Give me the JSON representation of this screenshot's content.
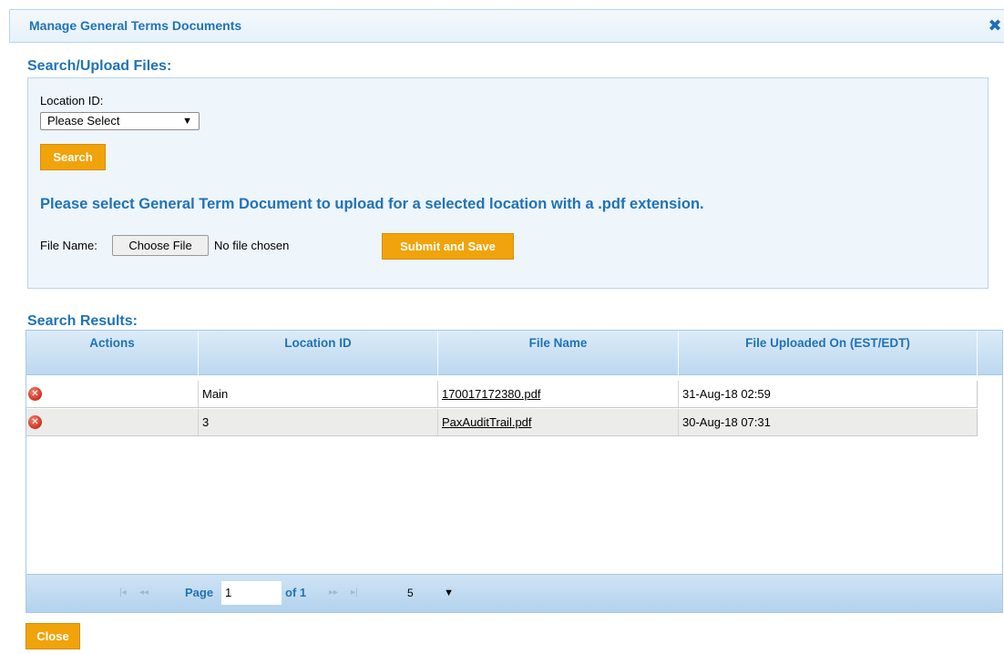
{
  "dialog": {
    "title": "Manage General Terms Documents",
    "close_icon": "close-x-icon"
  },
  "search_section": {
    "heading": "Search/Upload Files:",
    "location_label": "Location ID:",
    "location_selected": "Please Select",
    "search_button": "Search",
    "upload_message": "Please select General Term Document to upload for a selected location with a .pdf extension.",
    "file_label": "File Name:",
    "choose_file_button": "Choose File",
    "no_file_text": "No file chosen",
    "submit_button": "Submit and Save"
  },
  "results": {
    "heading": "Search Results:",
    "columns": [
      "Actions",
      "Location ID",
      "File Name",
      "File Uploaded On (EST/EDT)"
    ],
    "rows": [
      {
        "location_id": "Main",
        "file_name": "170017172380.pdf",
        "uploaded_on": "31-Aug-18 02:59"
      },
      {
        "location_id": "3",
        "file_name": "PaxAuditTrail.pdf",
        "uploaded_on": "30-Aug-18 07:31"
      }
    ]
  },
  "pager": {
    "page_label": "Page",
    "page_value": "1",
    "of_label": "of 1",
    "page_size": "5"
  },
  "footer": {
    "close_button": "Close"
  },
  "colors": {
    "accent_blue": "#1f73b7",
    "button_orange": "#f0a30a",
    "panel_bg": "#eef5fb"
  }
}
